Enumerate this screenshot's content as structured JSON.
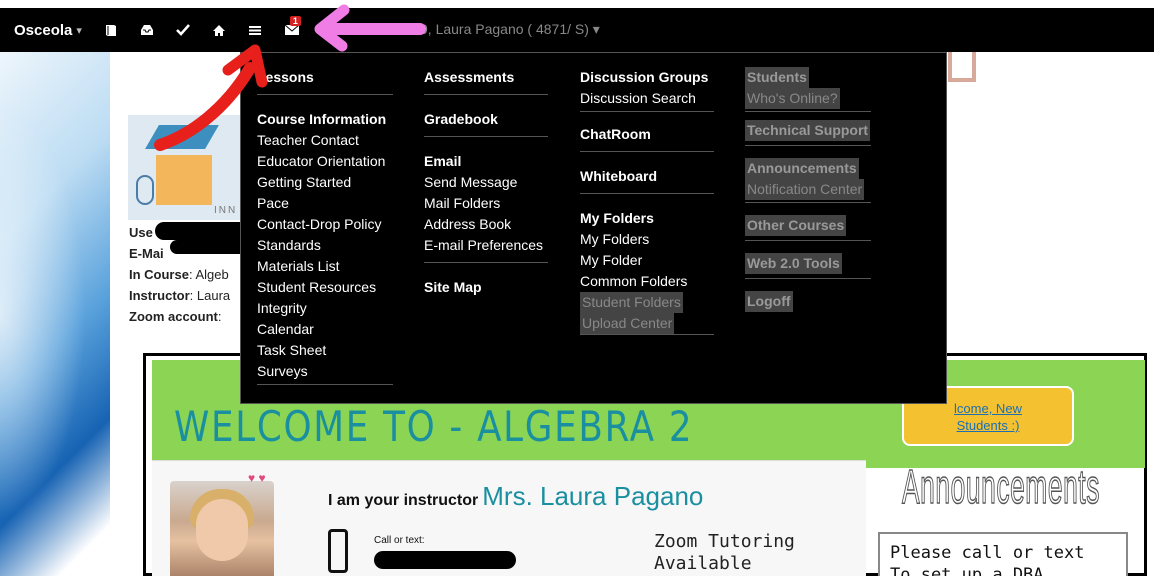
{
  "topbar": {
    "brand": "Osceola",
    "caret": "▾",
    "mail_badge": "1",
    "user": "9, Laura Pagano ( 4871/ S) ▾"
  },
  "page": {
    "info": [
      {
        "label": "Use",
        "value": ""
      },
      {
        "label": "E-Mai",
        "value": ""
      },
      {
        "label": "In Course",
        "value": ": Algeb"
      },
      {
        "label": "Instructor",
        "value": ": Laura"
      },
      {
        "label": "Zoom account",
        "value": ":"
      }
    ],
    "logo_text": "INN",
    "welcome_title": "WELCOME TO - ALGEBRA 2",
    "new_students": [
      "lcome, New",
      "Students :)"
    ],
    "iam": "I am your instructor",
    "iam_name": "Mrs. Laura Pagano",
    "call_or_text": "Call or text:",
    "zoom_tutoring": [
      "Zoom Tutoring",
      "Available"
    ],
    "announcements_title": "Announcements",
    "announcement_box": [
      "Please call or text",
      "To set up a DBA"
    ]
  },
  "menu": {
    "col1": {
      "lessons": "Lessons",
      "course_info": "Course Information",
      "items": [
        "Teacher Contact",
        "Educator Orientation",
        "Getting Started",
        "Pace",
        "Contact-Drop Policy",
        "Standards",
        "Materials List",
        "Student Resources",
        "Integrity",
        "Calendar",
        "Task Sheet",
        "Surveys"
      ]
    },
    "col2": {
      "assessments": "Assessments",
      "gradebook": "Gradebook",
      "email": "Email",
      "email_items": [
        "Send Message",
        "Mail Folders",
        "Address Book",
        "E-mail Preferences"
      ],
      "site_map": "Site Map"
    },
    "col3": {
      "discussion_groups": "Discussion Groups",
      "discussion_search": "Discussion Search",
      "chatroom": "ChatRoom",
      "whiteboard": "Whiteboard",
      "my_folders_head": "My Folders",
      "folder_items": [
        "My Folders",
        "My Folder",
        "Common Folders"
      ],
      "disabled_items": [
        "Student Folders",
        "Upload Center"
      ]
    },
    "col4": {
      "students": "Students",
      "whos_online": "Who's Online?",
      "tech_support": "Technical Support",
      "announcements": "Announcements",
      "notification_center": "Notification Center",
      "other_courses": "Other Courses",
      "web_tools": "Web 2.0 Tools",
      "logoff": "Logoff"
    }
  },
  "colors": {
    "annotation_red": "#e8201c",
    "annotation_pink": "#f07de6",
    "menu_bg": "#000000",
    "welcome_green": "#8cd454"
  }
}
